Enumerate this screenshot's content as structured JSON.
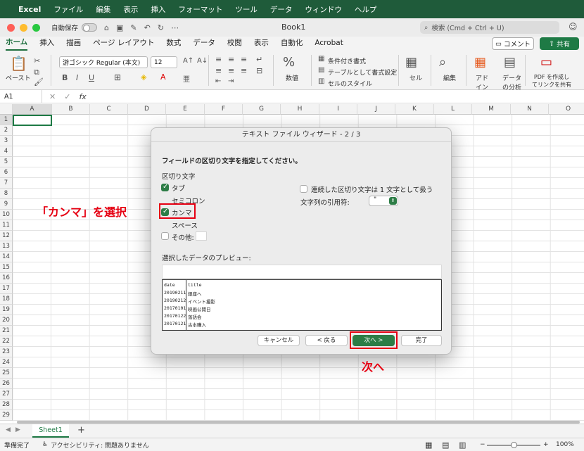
{
  "menubar": {
    "app": "Excel",
    "items": [
      "ファイル",
      "編集",
      "表示",
      "挿入",
      "フォーマット",
      "ツール",
      "データ",
      "ウィンドウ",
      "ヘルプ"
    ]
  },
  "titlebar": {
    "autosave": "自動保存",
    "doc_title": "Book1",
    "search": "検索 (Cmd + Ctrl + U)"
  },
  "ribbon_tabs": [
    "ホーム",
    "挿入",
    "描画",
    "ページ レイアウト",
    "数式",
    "データ",
    "校閲",
    "表示",
    "自動化",
    "Acrobat"
  ],
  "comment_label": "コメント",
  "share_label": "共有",
  "ribbon": {
    "paste": "ペースト",
    "font": "游ゴシック Regular (本文)",
    "font_size": "12",
    "number": "数値",
    "cond_format": "条件付き書式",
    "table_format": "テーブルとして書式設定",
    "cell_style": "セルのスタイル",
    "cell": "セル",
    "edit": "編集",
    "addin": "アド\nイン",
    "data_analysis": "データ\nの分析",
    "pdf": "PDF を作成し\nてリンクを共有"
  },
  "formula": {
    "namebox": "A1",
    "fx": "fx"
  },
  "columns": [
    "A",
    "B",
    "C",
    "D",
    "E",
    "F",
    "G",
    "H",
    "I",
    "J",
    "K",
    "L",
    "M",
    "N",
    "O"
  ],
  "rows": [
    "1",
    "2",
    "3",
    "4",
    "5",
    "6",
    "7",
    "8",
    "9",
    "10",
    "11",
    "12",
    "13",
    "14",
    "15",
    "16",
    "17",
    "18",
    "19",
    "20",
    "21",
    "22",
    "23",
    "24",
    "25",
    "26",
    "27",
    "28",
    "29"
  ],
  "dialog": {
    "title": "テキスト ファイル ウィザード - 2 / 3",
    "heading": "フィールドの区切り文字を指定してください。",
    "delim_label": "区切り文字",
    "tab": "タブ",
    "semicolon": "セミコロン",
    "comma": "カンマ",
    "space": "スペース",
    "other": "その他:",
    "consecutive": "連続した区切り文字は 1 文字として扱う",
    "quote_label": "文字列の引用符:",
    "quote_value": "\"",
    "preview_label": "選択したデータのプレビュー:",
    "preview_rows": [
      [
        "date",
        "title"
      ],
      [
        "20190211",
        "銀座へ"
      ],
      [
        "20190212",
        "イベント撮影"
      ],
      [
        "20170101",
        "映画公開日"
      ],
      [
        "20170122",
        "落語会"
      ],
      [
        "20170121",
        "古本購入"
      ]
    ],
    "cancel": "キャンセル",
    "back": "< 戻る",
    "next": "次へ >",
    "finish": "完了"
  },
  "annotations": {
    "select_comma": "「カンマ」を選択",
    "next": "次へ"
  },
  "sheet_tab": "Sheet1",
  "status": {
    "ready": "準備完了",
    "accessibility": "アクセシビリティ: 問題ありません",
    "zoom": "100%"
  },
  "colors": {
    "accent": "#1e7a45",
    "annotation": "#e60012"
  }
}
